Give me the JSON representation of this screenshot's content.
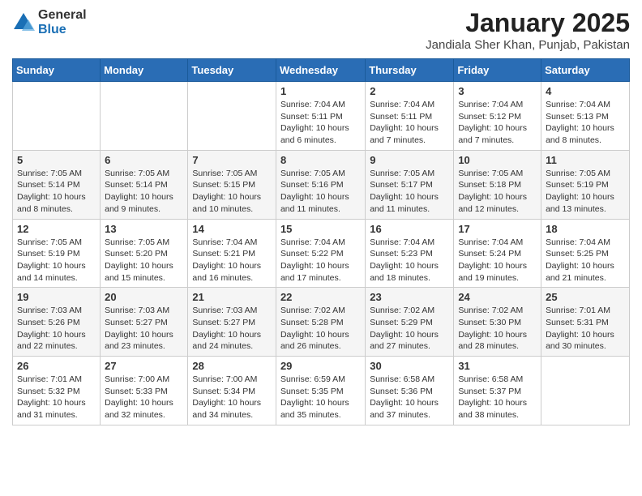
{
  "logo": {
    "general": "General",
    "blue": "Blue"
  },
  "title": "January 2025",
  "subtitle": "Jandiala Sher Khan, Punjab, Pakistan",
  "days_of_week": [
    "Sunday",
    "Monday",
    "Tuesday",
    "Wednesday",
    "Thursday",
    "Friday",
    "Saturday"
  ],
  "weeks": [
    [
      {
        "day": "",
        "info": ""
      },
      {
        "day": "",
        "info": ""
      },
      {
        "day": "",
        "info": ""
      },
      {
        "day": "1",
        "info": "Sunrise: 7:04 AM\nSunset: 5:11 PM\nDaylight: 10 hours and 6 minutes."
      },
      {
        "day": "2",
        "info": "Sunrise: 7:04 AM\nSunset: 5:11 PM\nDaylight: 10 hours and 7 minutes."
      },
      {
        "day": "3",
        "info": "Sunrise: 7:04 AM\nSunset: 5:12 PM\nDaylight: 10 hours and 7 minutes."
      },
      {
        "day": "4",
        "info": "Sunrise: 7:04 AM\nSunset: 5:13 PM\nDaylight: 10 hours and 8 minutes."
      }
    ],
    [
      {
        "day": "5",
        "info": "Sunrise: 7:05 AM\nSunset: 5:14 PM\nDaylight: 10 hours and 8 minutes."
      },
      {
        "day": "6",
        "info": "Sunrise: 7:05 AM\nSunset: 5:14 PM\nDaylight: 10 hours and 9 minutes."
      },
      {
        "day": "7",
        "info": "Sunrise: 7:05 AM\nSunset: 5:15 PM\nDaylight: 10 hours and 10 minutes."
      },
      {
        "day": "8",
        "info": "Sunrise: 7:05 AM\nSunset: 5:16 PM\nDaylight: 10 hours and 11 minutes."
      },
      {
        "day": "9",
        "info": "Sunrise: 7:05 AM\nSunset: 5:17 PM\nDaylight: 10 hours and 11 minutes."
      },
      {
        "day": "10",
        "info": "Sunrise: 7:05 AM\nSunset: 5:18 PM\nDaylight: 10 hours and 12 minutes."
      },
      {
        "day": "11",
        "info": "Sunrise: 7:05 AM\nSunset: 5:19 PM\nDaylight: 10 hours and 13 minutes."
      }
    ],
    [
      {
        "day": "12",
        "info": "Sunrise: 7:05 AM\nSunset: 5:19 PM\nDaylight: 10 hours and 14 minutes."
      },
      {
        "day": "13",
        "info": "Sunrise: 7:05 AM\nSunset: 5:20 PM\nDaylight: 10 hours and 15 minutes."
      },
      {
        "day": "14",
        "info": "Sunrise: 7:04 AM\nSunset: 5:21 PM\nDaylight: 10 hours and 16 minutes."
      },
      {
        "day": "15",
        "info": "Sunrise: 7:04 AM\nSunset: 5:22 PM\nDaylight: 10 hours and 17 minutes."
      },
      {
        "day": "16",
        "info": "Sunrise: 7:04 AM\nSunset: 5:23 PM\nDaylight: 10 hours and 18 minutes."
      },
      {
        "day": "17",
        "info": "Sunrise: 7:04 AM\nSunset: 5:24 PM\nDaylight: 10 hours and 19 minutes."
      },
      {
        "day": "18",
        "info": "Sunrise: 7:04 AM\nSunset: 5:25 PM\nDaylight: 10 hours and 21 minutes."
      }
    ],
    [
      {
        "day": "19",
        "info": "Sunrise: 7:03 AM\nSunset: 5:26 PM\nDaylight: 10 hours and 22 minutes."
      },
      {
        "day": "20",
        "info": "Sunrise: 7:03 AM\nSunset: 5:27 PM\nDaylight: 10 hours and 23 minutes."
      },
      {
        "day": "21",
        "info": "Sunrise: 7:03 AM\nSunset: 5:27 PM\nDaylight: 10 hours and 24 minutes."
      },
      {
        "day": "22",
        "info": "Sunrise: 7:02 AM\nSunset: 5:28 PM\nDaylight: 10 hours and 26 minutes."
      },
      {
        "day": "23",
        "info": "Sunrise: 7:02 AM\nSunset: 5:29 PM\nDaylight: 10 hours and 27 minutes."
      },
      {
        "day": "24",
        "info": "Sunrise: 7:02 AM\nSunset: 5:30 PM\nDaylight: 10 hours and 28 minutes."
      },
      {
        "day": "25",
        "info": "Sunrise: 7:01 AM\nSunset: 5:31 PM\nDaylight: 10 hours and 30 minutes."
      }
    ],
    [
      {
        "day": "26",
        "info": "Sunrise: 7:01 AM\nSunset: 5:32 PM\nDaylight: 10 hours and 31 minutes."
      },
      {
        "day": "27",
        "info": "Sunrise: 7:00 AM\nSunset: 5:33 PM\nDaylight: 10 hours and 32 minutes."
      },
      {
        "day": "28",
        "info": "Sunrise: 7:00 AM\nSunset: 5:34 PM\nDaylight: 10 hours and 34 minutes."
      },
      {
        "day": "29",
        "info": "Sunrise: 6:59 AM\nSunset: 5:35 PM\nDaylight: 10 hours and 35 minutes."
      },
      {
        "day": "30",
        "info": "Sunrise: 6:58 AM\nSunset: 5:36 PM\nDaylight: 10 hours and 37 minutes."
      },
      {
        "day": "31",
        "info": "Sunrise: 6:58 AM\nSunset: 5:37 PM\nDaylight: 10 hours and 38 minutes."
      },
      {
        "day": "",
        "info": ""
      }
    ]
  ]
}
